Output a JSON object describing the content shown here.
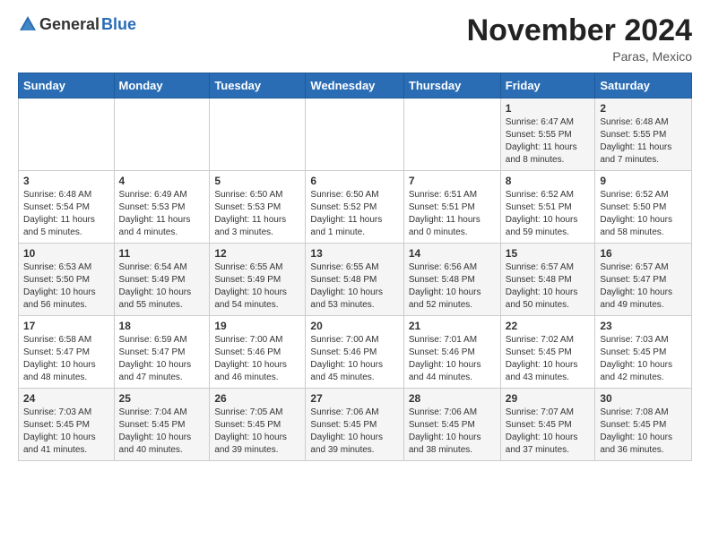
{
  "header": {
    "logo_general": "General",
    "logo_blue": "Blue",
    "month": "November 2024",
    "location": "Paras, Mexico"
  },
  "weekdays": [
    "Sunday",
    "Monday",
    "Tuesday",
    "Wednesday",
    "Thursday",
    "Friday",
    "Saturday"
  ],
  "weeks": [
    [
      {
        "day": "",
        "info": ""
      },
      {
        "day": "",
        "info": ""
      },
      {
        "day": "",
        "info": ""
      },
      {
        "day": "",
        "info": ""
      },
      {
        "day": "",
        "info": ""
      },
      {
        "day": "1",
        "info": "Sunrise: 6:47 AM\nSunset: 5:55 PM\nDaylight: 11 hours\nand 8 minutes."
      },
      {
        "day": "2",
        "info": "Sunrise: 6:48 AM\nSunset: 5:55 PM\nDaylight: 11 hours\nand 7 minutes."
      }
    ],
    [
      {
        "day": "3",
        "info": "Sunrise: 6:48 AM\nSunset: 5:54 PM\nDaylight: 11 hours\nand 5 minutes."
      },
      {
        "day": "4",
        "info": "Sunrise: 6:49 AM\nSunset: 5:53 PM\nDaylight: 11 hours\nand 4 minutes."
      },
      {
        "day": "5",
        "info": "Sunrise: 6:50 AM\nSunset: 5:53 PM\nDaylight: 11 hours\nand 3 minutes."
      },
      {
        "day": "6",
        "info": "Sunrise: 6:50 AM\nSunset: 5:52 PM\nDaylight: 11 hours\nand 1 minute."
      },
      {
        "day": "7",
        "info": "Sunrise: 6:51 AM\nSunset: 5:51 PM\nDaylight: 11 hours\nand 0 minutes."
      },
      {
        "day": "8",
        "info": "Sunrise: 6:52 AM\nSunset: 5:51 PM\nDaylight: 10 hours\nand 59 minutes."
      },
      {
        "day": "9",
        "info": "Sunrise: 6:52 AM\nSunset: 5:50 PM\nDaylight: 10 hours\nand 58 minutes."
      }
    ],
    [
      {
        "day": "10",
        "info": "Sunrise: 6:53 AM\nSunset: 5:50 PM\nDaylight: 10 hours\nand 56 minutes."
      },
      {
        "day": "11",
        "info": "Sunrise: 6:54 AM\nSunset: 5:49 PM\nDaylight: 10 hours\nand 55 minutes."
      },
      {
        "day": "12",
        "info": "Sunrise: 6:55 AM\nSunset: 5:49 PM\nDaylight: 10 hours\nand 54 minutes."
      },
      {
        "day": "13",
        "info": "Sunrise: 6:55 AM\nSunset: 5:48 PM\nDaylight: 10 hours\nand 53 minutes."
      },
      {
        "day": "14",
        "info": "Sunrise: 6:56 AM\nSunset: 5:48 PM\nDaylight: 10 hours\nand 52 minutes."
      },
      {
        "day": "15",
        "info": "Sunrise: 6:57 AM\nSunset: 5:48 PM\nDaylight: 10 hours\nand 50 minutes."
      },
      {
        "day": "16",
        "info": "Sunrise: 6:57 AM\nSunset: 5:47 PM\nDaylight: 10 hours\nand 49 minutes."
      }
    ],
    [
      {
        "day": "17",
        "info": "Sunrise: 6:58 AM\nSunset: 5:47 PM\nDaylight: 10 hours\nand 48 minutes."
      },
      {
        "day": "18",
        "info": "Sunrise: 6:59 AM\nSunset: 5:47 PM\nDaylight: 10 hours\nand 47 minutes."
      },
      {
        "day": "19",
        "info": "Sunrise: 7:00 AM\nSunset: 5:46 PM\nDaylight: 10 hours\nand 46 minutes."
      },
      {
        "day": "20",
        "info": "Sunrise: 7:00 AM\nSunset: 5:46 PM\nDaylight: 10 hours\nand 45 minutes."
      },
      {
        "day": "21",
        "info": "Sunrise: 7:01 AM\nSunset: 5:46 PM\nDaylight: 10 hours\nand 44 minutes."
      },
      {
        "day": "22",
        "info": "Sunrise: 7:02 AM\nSunset: 5:45 PM\nDaylight: 10 hours\nand 43 minutes."
      },
      {
        "day": "23",
        "info": "Sunrise: 7:03 AM\nSunset: 5:45 PM\nDaylight: 10 hours\nand 42 minutes."
      }
    ],
    [
      {
        "day": "24",
        "info": "Sunrise: 7:03 AM\nSunset: 5:45 PM\nDaylight: 10 hours\nand 41 minutes."
      },
      {
        "day": "25",
        "info": "Sunrise: 7:04 AM\nSunset: 5:45 PM\nDaylight: 10 hours\nand 40 minutes."
      },
      {
        "day": "26",
        "info": "Sunrise: 7:05 AM\nSunset: 5:45 PM\nDaylight: 10 hours\nand 39 minutes."
      },
      {
        "day": "27",
        "info": "Sunrise: 7:06 AM\nSunset: 5:45 PM\nDaylight: 10 hours\nand 39 minutes."
      },
      {
        "day": "28",
        "info": "Sunrise: 7:06 AM\nSunset: 5:45 PM\nDaylight: 10 hours\nand 38 minutes."
      },
      {
        "day": "29",
        "info": "Sunrise: 7:07 AM\nSunset: 5:45 PM\nDaylight: 10 hours\nand 37 minutes."
      },
      {
        "day": "30",
        "info": "Sunrise: 7:08 AM\nSunset: 5:45 PM\nDaylight: 10 hours\nand 36 minutes."
      }
    ]
  ]
}
